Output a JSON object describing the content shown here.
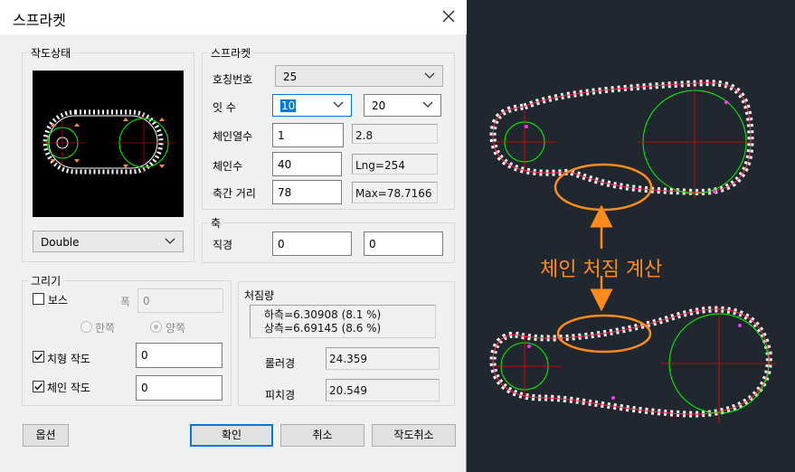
{
  "dialog": {
    "title": "스프라켓",
    "drawing_state": {
      "title": "작도상태",
      "style_value": "Double"
    },
    "sprocket": {
      "title": "스프라켓",
      "nominal_label": "호칭번호",
      "nominal_value": "25",
      "teeth_label": "잇 수",
      "teeth_1": "10",
      "teeth_2": "20",
      "chain_rows_label": "체인열수",
      "chain_rows_value": "1",
      "chain_rows_readout": "2.8",
      "chain_links_label": "체인수",
      "chain_links_value": "40",
      "chain_links_readout": "Lng=254",
      "center_dist_label": "축간 거리",
      "center_dist_value": "78",
      "center_dist_readout": "Max=78.7166"
    },
    "shaft": {
      "title": "축",
      "diameter_label": "직경",
      "diameter_1": "0",
      "diameter_2": "0"
    },
    "draw": {
      "title": "그리기",
      "boss_label": "보스",
      "width_label": "폭",
      "width_value": "0",
      "one_side_label": "한쪽",
      "both_side_label": "양쪽",
      "tooth_label": "치형 작도",
      "tooth_value": "0",
      "chain_label": "체인 작도",
      "chain_value": "0"
    },
    "sag": {
      "title": "처짐량",
      "lower": "하측=6.30908 (8.1 %)",
      "upper": "상측=6.69145 (8.6 %)",
      "roller_label": "롤러경",
      "roller_value": "24.359",
      "pitch_label": "피치경",
      "pitch_value": "20.549"
    },
    "buttons": {
      "options": "옵션",
      "ok": "확인",
      "cancel": "취소",
      "cancel_draw": "작도취소"
    }
  },
  "annotation": {
    "text": "체인 처짐 계산",
    "color": "#ff8c1a"
  },
  "colors": {
    "accent": "#0078d7",
    "cad_background": "#20272f",
    "sprocket": "#00ff00",
    "centerline": "#ff0000"
  }
}
